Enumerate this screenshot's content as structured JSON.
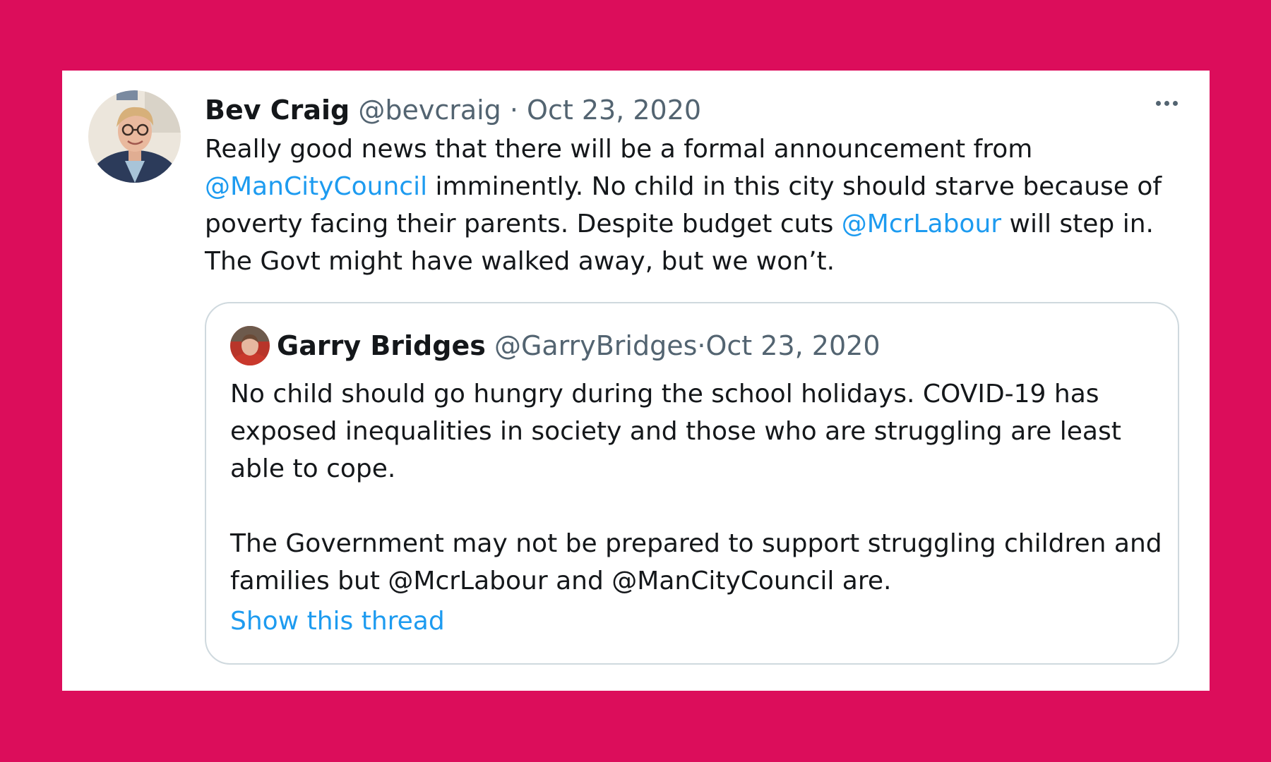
{
  "tweet": {
    "author_name": "Bev Craig",
    "author_handle": "@bevcraig",
    "separator": " · ",
    "date": "Oct 23, 2020",
    "text_parts": {
      "p1": "Really good news that there will be a formal announcement from ",
      "m1": "@ManCityCouncil",
      "p2": " imminently. No child in this city should starve because of poverty facing their parents. Despite budget cuts ",
      "m2": "@McrLabour",
      "p3": " will step in. The Govt might have walked away, but we won’t."
    },
    "more_icon": "more-horizontal-icon"
  },
  "quoted_tweet": {
    "author_name": "Garry Bridges",
    "author_handle": "@GarryBridges",
    "separator": " · ",
    "date": "Oct 23, 2020",
    "paragraph1": "No child should go hungry during the school holidays. COVID-19 has exposed inequalities in society and those who are struggling are least able to cope.",
    "paragraph2": "The Government may not be prepared to support struggling children and families but @McrLabour and @ManCityCouncil are.",
    "show_thread": "Show this thread"
  },
  "colors": {
    "background": "#dc0d5b",
    "card": "#ffffff",
    "link": "#1d9bf0",
    "text": "#14171a",
    "muted": "#536471"
  }
}
